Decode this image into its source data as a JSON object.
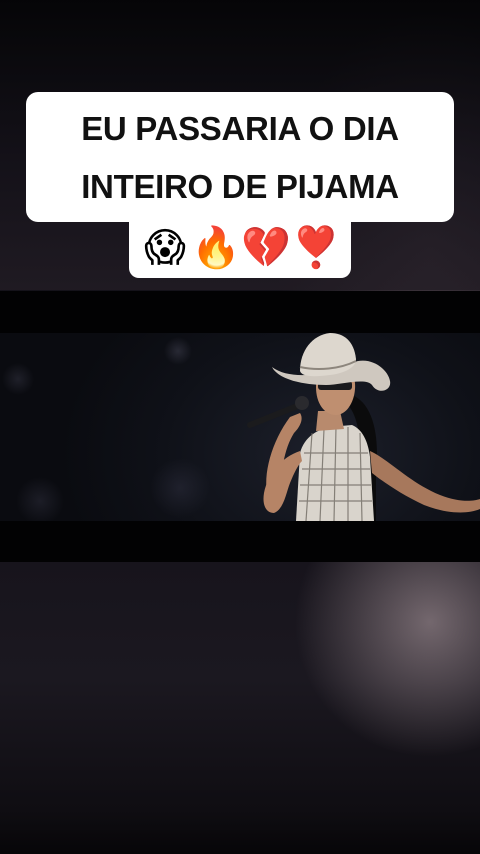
{
  "caption": {
    "line1": "EU PASSARIA O DIA",
    "line2": "INTEIRO DE PIJAMA",
    "emojis": [
      "😱",
      "🔥",
      "💔",
      "❣️"
    ],
    "emoji_names": [
      "scared-face-icon",
      "fire-icon",
      "broken-heart-icon",
      "heart-exclamation-icon"
    ]
  },
  "colors": {
    "caption_bg": "#ffffff",
    "caption_text": "#111111",
    "video_bg": "#0f1118"
  }
}
